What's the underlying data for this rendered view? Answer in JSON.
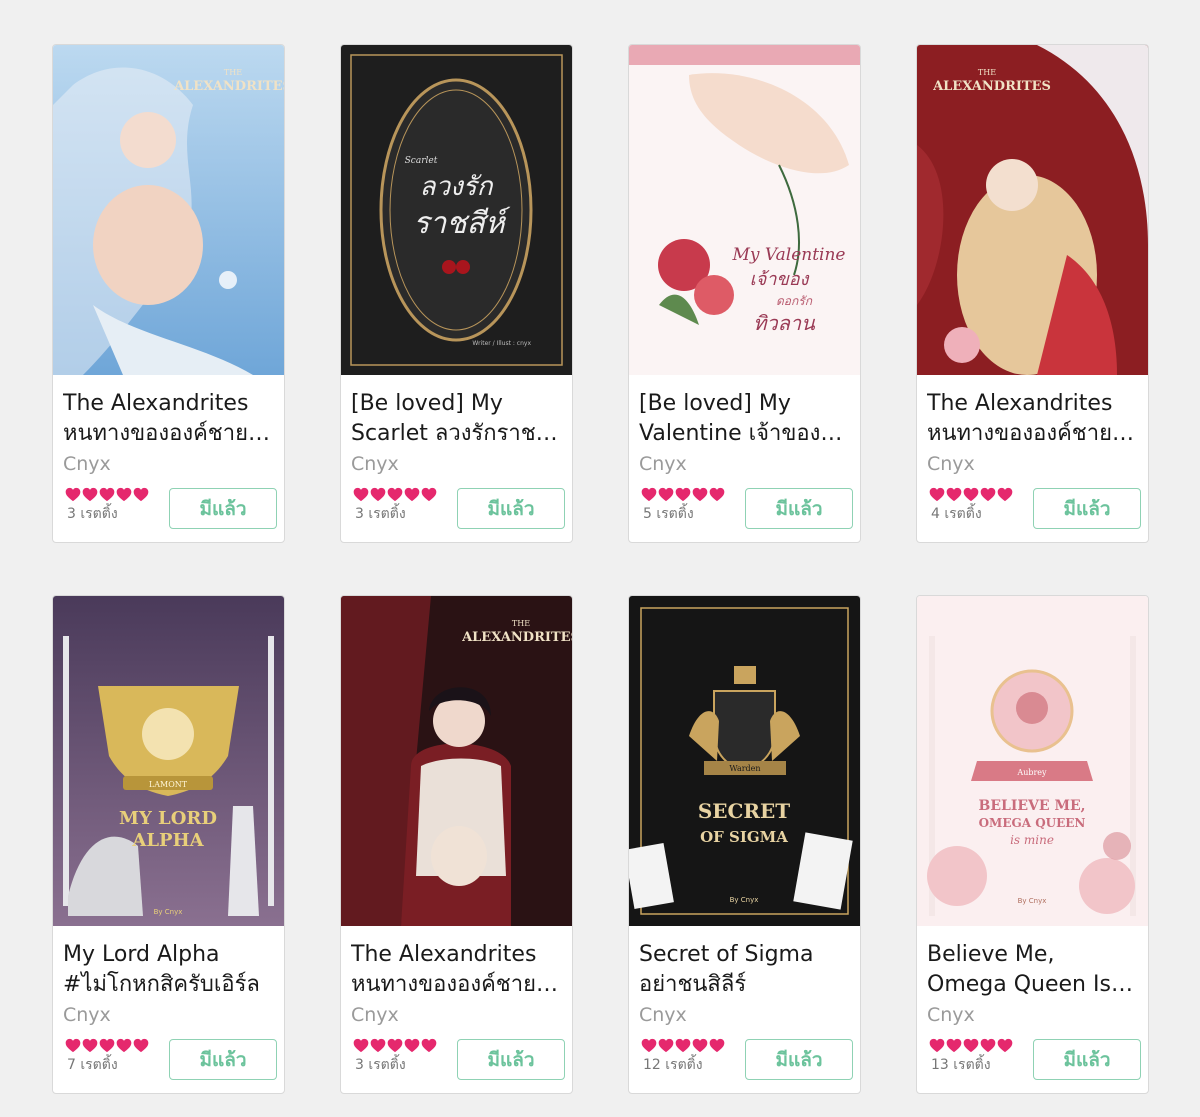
{
  "books": [
    {
      "title_line1": "The Alexandrites",
      "title_line2": "หนทางขององค์ชาย…",
      "author": "Cnyx",
      "rating_count": "3 เรตติ้ง",
      "button": "มีแล้ว",
      "cover": {
        "theme": "merman-blue",
        "colors": [
          "#bcd9f0",
          "#6fa6d8",
          "#e9eef6"
        ]
      },
      "cover_text": [
        "THE",
        "ALEXANDRITES"
      ]
    },
    {
      "title_line1": "[Be loved] My",
      "title_line2": "Scarlet ลวงรักราช…",
      "author": "Cnyx",
      "rating_count": "3 เรตติ้ง",
      "button": "มีแล้ว",
      "cover": {
        "theme": "dark-mirror",
        "colors": [
          "#1e1e1e",
          "#2a2a2a",
          "#b8955a"
        ]
      },
      "cover_text": [
        "Scarlet",
        "ลวงรัก",
        "ราชสีห์",
        "Writer / Illust : cnyx"
      ]
    },
    {
      "title_line1": "[Be loved] My",
      "title_line2": "Valentine เจ้าของ…",
      "author": "Cnyx",
      "rating_count": "5 เรตติ้ง",
      "button": "มีแล้ว",
      "cover": {
        "theme": "pink-hands",
        "colors": [
          "#fbf4f4",
          "#e9a9b4",
          "#c83a4c"
        ]
      },
      "cover_text": [
        "My Valentine",
        "เจ้าของ",
        "ดอกรัก",
        "ทิวลาน"
      ]
    },
    {
      "title_line1": "The Alexandrites",
      "title_line2": "หนทางขององค์ชาย…",
      "author": "Cnyx",
      "rating_count": "4 เรตติ้ง",
      "button": "มีแล้ว",
      "cover": {
        "theme": "red-angel",
        "colors": [
          "#8c1e22",
          "#d9a9a6",
          "#f0d9a8"
        ]
      },
      "cover_text": [
        "THE",
        "ALEXANDRITES"
      ]
    },
    {
      "title_line1": "My Lord Alpha",
      "title_line2": "#ไม่โกหกสิครับเอิร์ล",
      "author": "Cnyx",
      "rating_count": "7 เรตติ้ง",
      "button": "มีแล้ว",
      "cover": {
        "theme": "purple-chess",
        "colors": [
          "#4a3a5a",
          "#8a7090",
          "#d9b85a"
        ]
      },
      "cover_text": [
        "LAMONT",
        "MY LORD",
        "ALPHA",
        "By Cnyx"
      ]
    },
    {
      "title_line1": "The Alexandrites",
      "title_line2": "หนทางขององค์ชาย…",
      "author": "Cnyx",
      "rating_count": "3 เรตติ้ง",
      "button": "มีแล้ว",
      "cover": {
        "theme": "dark-prince",
        "colors": [
          "#2a1214",
          "#7a1e24",
          "#eae0d8"
        ]
      },
      "cover_text": [
        "THE",
        "ALEXANDRITES"
      ]
    },
    {
      "title_line1": "Secret of Sigma",
      "title_line2": "อย่าชนสิลีร์",
      "author": "Cnyx",
      "rating_count": "12 เรตติ้ง",
      "button": "มีแล้ว",
      "cover": {
        "theme": "black-crest",
        "colors": [
          "#151515",
          "#2a2a2a",
          "#c9a45e"
        ]
      },
      "cover_text": [
        "Warden",
        "SECRET",
        "OF SIGMA",
        "By Cnyx"
      ]
    },
    {
      "title_line1": "Believe Me,",
      "title_line2": "Omega Queen Is…",
      "author": "Cnyx",
      "rating_count": "13 เรตติ้ง",
      "button": "มีแล้ว",
      "cover": {
        "theme": "pink-rose",
        "colors": [
          "#fbeff0",
          "#f2c5c9",
          "#d98a92"
        ]
      },
      "cover_text": [
        "Aubrey",
        "BELIEVE ME,",
        "OMEGA QUEEN",
        "is mine",
        "By Cnyx"
      ]
    }
  ],
  "stars_per_book": 5,
  "colors": {
    "heart": "#e5286d",
    "button_border": "#8fd2b4",
    "button_text": "#6cc39c",
    "background": "#f0f0f0"
  }
}
